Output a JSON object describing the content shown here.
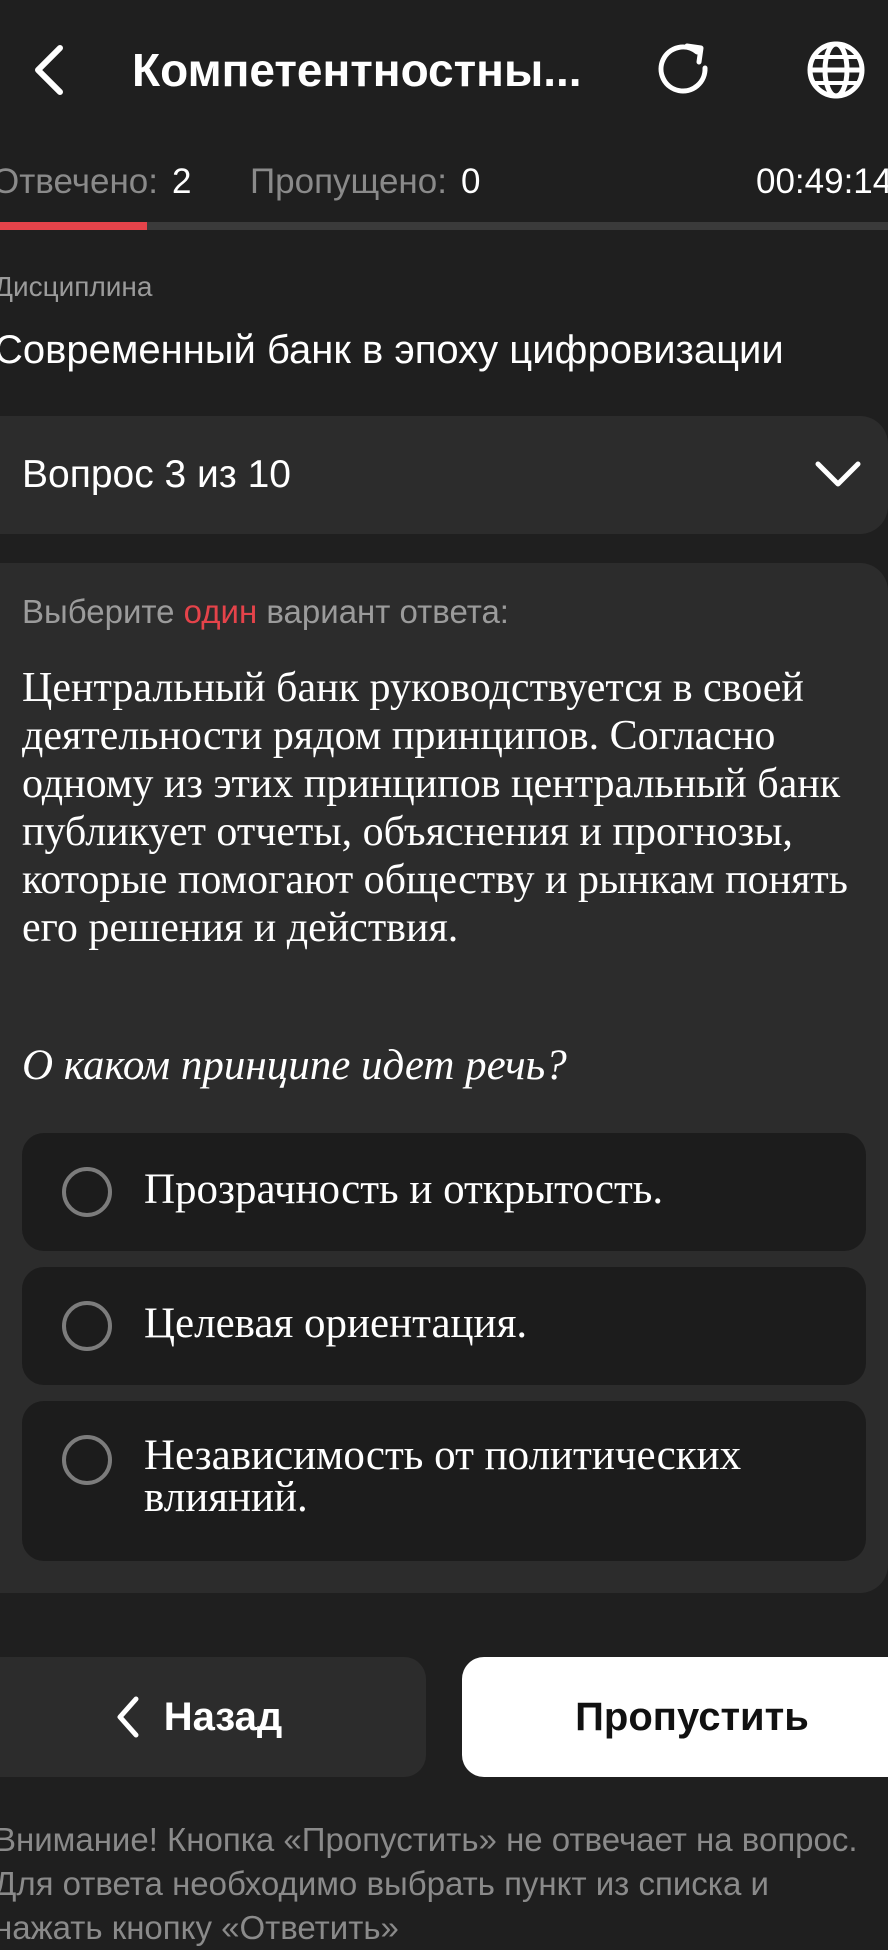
{
  "header": {
    "title": "Компетентностны...",
    "back_icon": "chevron-left-icon",
    "refresh_icon": "refresh-icon",
    "language_icon": "globe-icon"
  },
  "stats": {
    "answered_label": "Отвечено:",
    "answered_value": "2",
    "skipped_label": "Пропущено:",
    "skipped_value": "0",
    "timer": "00:49:14",
    "progress_fraction": 0.2
  },
  "discipline": {
    "label": "Дисциплина",
    "name": "Современный банк в эпоху цифровизации"
  },
  "question_selector": {
    "label": "Вопрос 3 из 10",
    "icon": "chevron-down-icon"
  },
  "question": {
    "instruction_prefix": "Выберите",
    "instruction_highlight": "один",
    "instruction_suffix": "вариант ответа:",
    "text": "Центральный банк руководствуется в своей деятельности рядом принципов. Согласно одному из этих принципов центральный банк публикует отчеты, объяснения и прогнозы, которые помогают обществу и рынкам понять его решения и действия.",
    "prompt": "О каком принципе идет речь?",
    "options": [
      {
        "label": "Прозрачность и открытость."
      },
      {
        "label": "Целевая ориентация."
      },
      {
        "label": "Независимость от политических влияний."
      }
    ]
  },
  "buttons": {
    "back_label": "Назад",
    "skip_label": "Пропустить"
  },
  "notice": "Внимание! Кнопка «Пропустить» не отвечает на вопрос. Для ответа необходимо выбрать пункт из списка и нажать кнопку «Ответить»",
  "colors": {
    "background": "#1f1f1f",
    "card": "#2c2c2c",
    "accent": "#e5434a",
    "option_bg": "#1c1c1c"
  }
}
